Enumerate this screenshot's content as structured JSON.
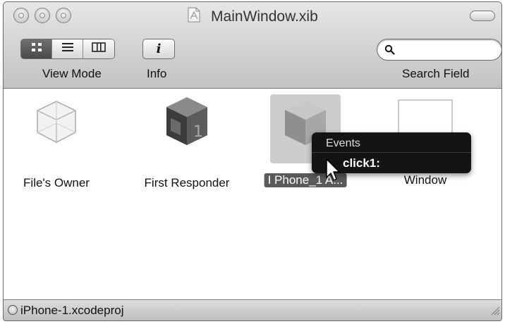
{
  "window": {
    "title": "MainWindow.xib"
  },
  "toolbar": {
    "view_mode_label": "View Mode",
    "info_label": "Info",
    "info_glyph": "i",
    "search_label": "Search Field",
    "search_value": "",
    "view_modes": [
      {
        "icon": "icon-view-icon",
        "selected": true
      },
      {
        "icon": "list-view-icon",
        "selected": false
      },
      {
        "icon": "column-view-icon",
        "selected": false
      }
    ]
  },
  "objects": [
    {
      "label": "File's Owner",
      "icon": "wireframe-cube-icon",
      "selected": false
    },
    {
      "label": "First Responder",
      "icon": "first-responder-cube-icon",
      "selected": false
    },
    {
      "label": "I Phone_1 A...",
      "icon": "shaded-cube-icon",
      "selected": true
    },
    {
      "label": "Window",
      "icon": "window-icon",
      "selected": false
    }
  ],
  "popup": {
    "header": "Events",
    "items": [
      "click1:"
    ]
  },
  "statusbar": {
    "project": "iPhone-1.xcodeproj"
  },
  "colors": {
    "toolbar_top": "#e6e6e6",
    "toolbar_bottom": "#c2c2c2",
    "selection_label": "#5a5a5a",
    "popup_bg": "#141414"
  }
}
